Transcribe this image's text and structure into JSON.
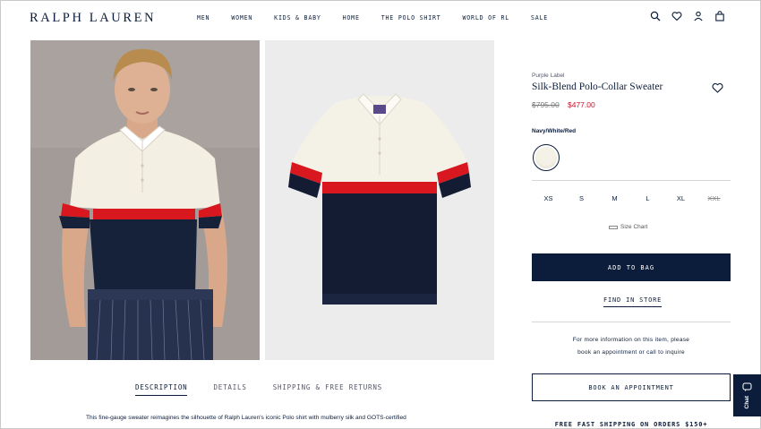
{
  "header": {
    "logo": "RALPH LAUREN",
    "nav": [
      "MEN",
      "WOMEN",
      "KIDS & BABY",
      "HOME",
      "THE POLO SHIRT",
      "WORLD OF RL",
      "SALE"
    ],
    "icons": [
      "search-icon",
      "heart-icon",
      "account-icon",
      "bag-icon"
    ]
  },
  "product": {
    "brand": "Purple Label",
    "title": "Silk-Blend Polo-Collar Sweater",
    "original_price": "$795.00",
    "sale_price": "$477.00",
    "color_name": "Navy/White/Red",
    "sizes": [
      {
        "label": "XS",
        "available": true
      },
      {
        "label": "S",
        "available": true
      },
      {
        "label": "M",
        "available": true
      },
      {
        "label": "L",
        "available": true
      },
      {
        "label": "XL",
        "available": true
      },
      {
        "label": "XXL",
        "available": false
      }
    ],
    "size_chart": "Size Chart",
    "add_to_bag": "ADD TO BAG",
    "find_in_store": "FIND IN STORE",
    "info_line1": "For more information on this item, please",
    "info_line2": "book an appointment or call to inquire",
    "book_appointment": "BOOK AN APPOINTMENT",
    "free_shipping": "FREE FAST SHIPPING ON ORDERS $150+"
  },
  "chat": {
    "label": "Chat"
  },
  "tabs": [
    {
      "label": "DESCRIPTION",
      "active": true
    },
    {
      "label": "DETAILS",
      "active": false
    },
    {
      "label": "SHIPPING & FREE RETURNS",
      "active": false
    }
  ],
  "description": "This fine-gauge sweater reimagines the silhouette of Ralph Lauren's iconic Polo shirt with mulberry silk and GOTS-certified",
  "colors": {
    "navy": "#0b1d3a",
    "sale_red": "#d0112b",
    "stripe_red": "#d8171f",
    "cream": "#f4f1e7"
  }
}
